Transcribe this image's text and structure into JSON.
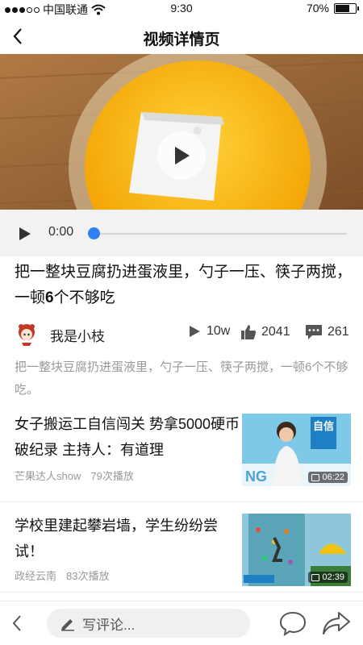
{
  "status_bar": {
    "carrier": "中国联通",
    "time": "9:30",
    "battery": "70%",
    "battery_level": 0.7
  },
  "nav": {
    "title": "视频详情页"
  },
  "player": {
    "time": "0:00",
    "progress": 0
  },
  "article": {
    "title_part1": "把一整块豆腐扔进蛋液里，勺子一压、筷子两搅，一顿",
    "title_num": "6",
    "title_part2": "个不够吃",
    "author": "我是小枝",
    "plays": "10w",
    "likes": "2041",
    "comments": "261",
    "description": "把一整块豆腐扔进蛋液里，勺子一压、筷子两搅，一顿6个不够吃。"
  },
  "recommendations": [
    {
      "title": "女子搬运工自信闯关 势拿5000硬币破纪录 主持人：有道理",
      "source": "芒果达人show",
      "plays": "79次播放",
      "duration": "06:22",
      "thumb_text": "自信"
    },
    {
      "title": "学校里建起攀岩墙，学生纷纷尝试！",
      "source": "政经云南",
      "plays": "83次播放",
      "duration": "02:39",
      "thumb_text": ""
    }
  ],
  "bottom_bar": {
    "comment_placeholder": "写评论..."
  }
}
